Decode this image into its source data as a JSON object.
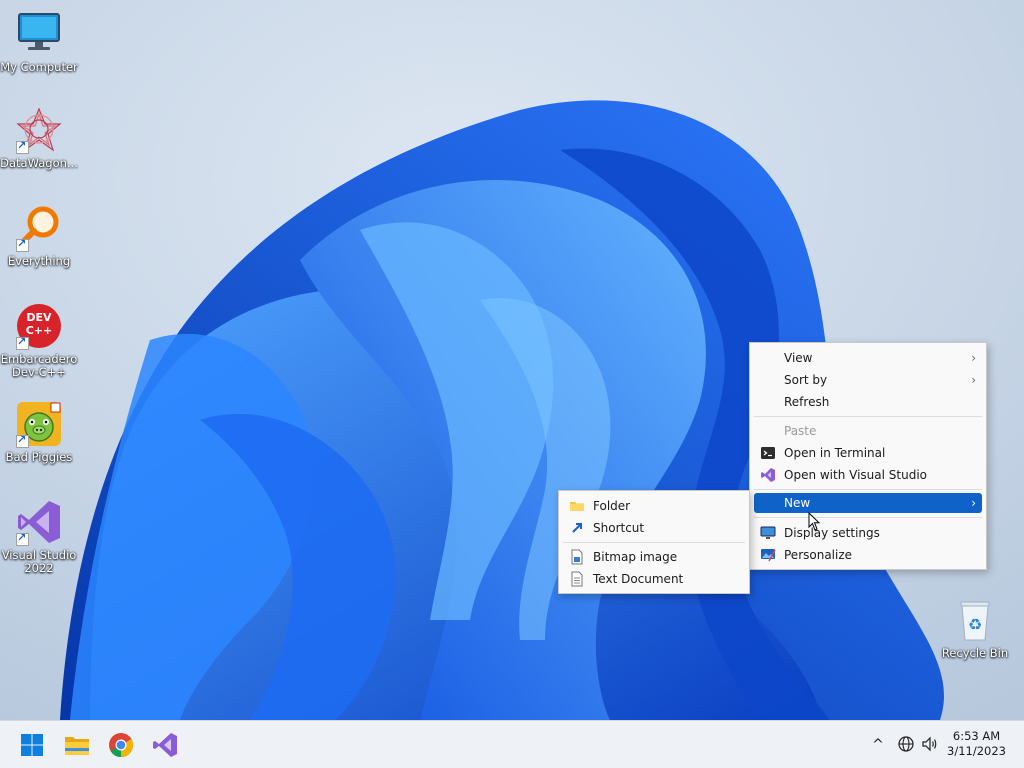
{
  "desktop": {
    "icons": [
      {
        "label": "My Computer"
      },
      {
        "label": "DataWagon..."
      },
      {
        "label": "Everything"
      },
      {
        "label": "Embarcadero Dev-C++"
      },
      {
        "label": "Bad Piggies"
      },
      {
        "label": "Visual Studio 2022"
      },
      {
        "label": "Recycle Bin"
      }
    ],
    "devcpp_icon_text": "DEV C++"
  },
  "context_menu": {
    "items": [
      {
        "label": "View",
        "submenu": true
      },
      {
        "label": "Sort by",
        "submenu": true
      },
      {
        "label": "Refresh"
      },
      {
        "label": "Paste",
        "disabled": true
      },
      {
        "label": "Open in Terminal"
      },
      {
        "label": "Open with Visual Studio"
      },
      {
        "label": "New",
        "submenu": true,
        "highlighted": true
      },
      {
        "label": "Display settings"
      },
      {
        "label": "Personalize"
      }
    ]
  },
  "new_submenu": {
    "items": [
      {
        "label": "Folder"
      },
      {
        "label": "Shortcut"
      },
      {
        "label": "Bitmap image"
      },
      {
        "label": "Text Document"
      }
    ]
  },
  "taskbar": {
    "pinned": [
      "start-icon",
      "file-explorer-icon",
      "chrome-icon",
      "visual-studio-icon"
    ],
    "tray": {
      "chevron": "^",
      "time": "6:53 AM",
      "date": "3/11/2023"
    }
  },
  "colors": {
    "accent": "#0f63c8",
    "bloom": "#1a5fe8",
    "background": "#c9d6e6"
  }
}
